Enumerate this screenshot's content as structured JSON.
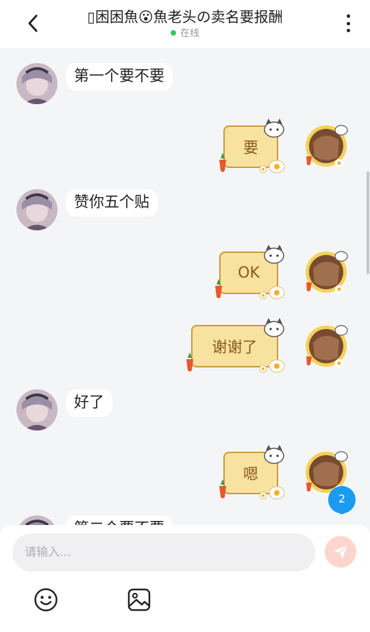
{
  "header": {
    "title": "▯困困魚😮魚老头の卖名要报酬",
    "status": "在线",
    "status_color": "#36c75a"
  },
  "messages": [
    {
      "side": "left",
      "text": "第一个要不要"
    },
    {
      "side": "right",
      "text": "要"
    },
    {
      "side": "left",
      "text": "赞你五个贴"
    },
    {
      "side": "right",
      "text": "OK"
    },
    {
      "side": "right",
      "text": "谢谢了"
    },
    {
      "side": "left",
      "text": "好了"
    },
    {
      "side": "right",
      "text": "嗯"
    },
    {
      "side": "left",
      "text": "第二个要不要"
    }
  ],
  "unread_badge": "2",
  "composer": {
    "placeholder": "请输入...",
    "value": ""
  },
  "icons": {
    "back": "back-arrow-icon",
    "more": "more-vertical-icon",
    "send": "send-icon",
    "emoji": "emoji-icon",
    "image": "image-icon"
  },
  "colors": {
    "accent_badge": "#1a9bf0",
    "sticker_fill": "#f8e2a0",
    "sticker_border": "#c89a3c",
    "send_button": "#fcd6cc"
  }
}
